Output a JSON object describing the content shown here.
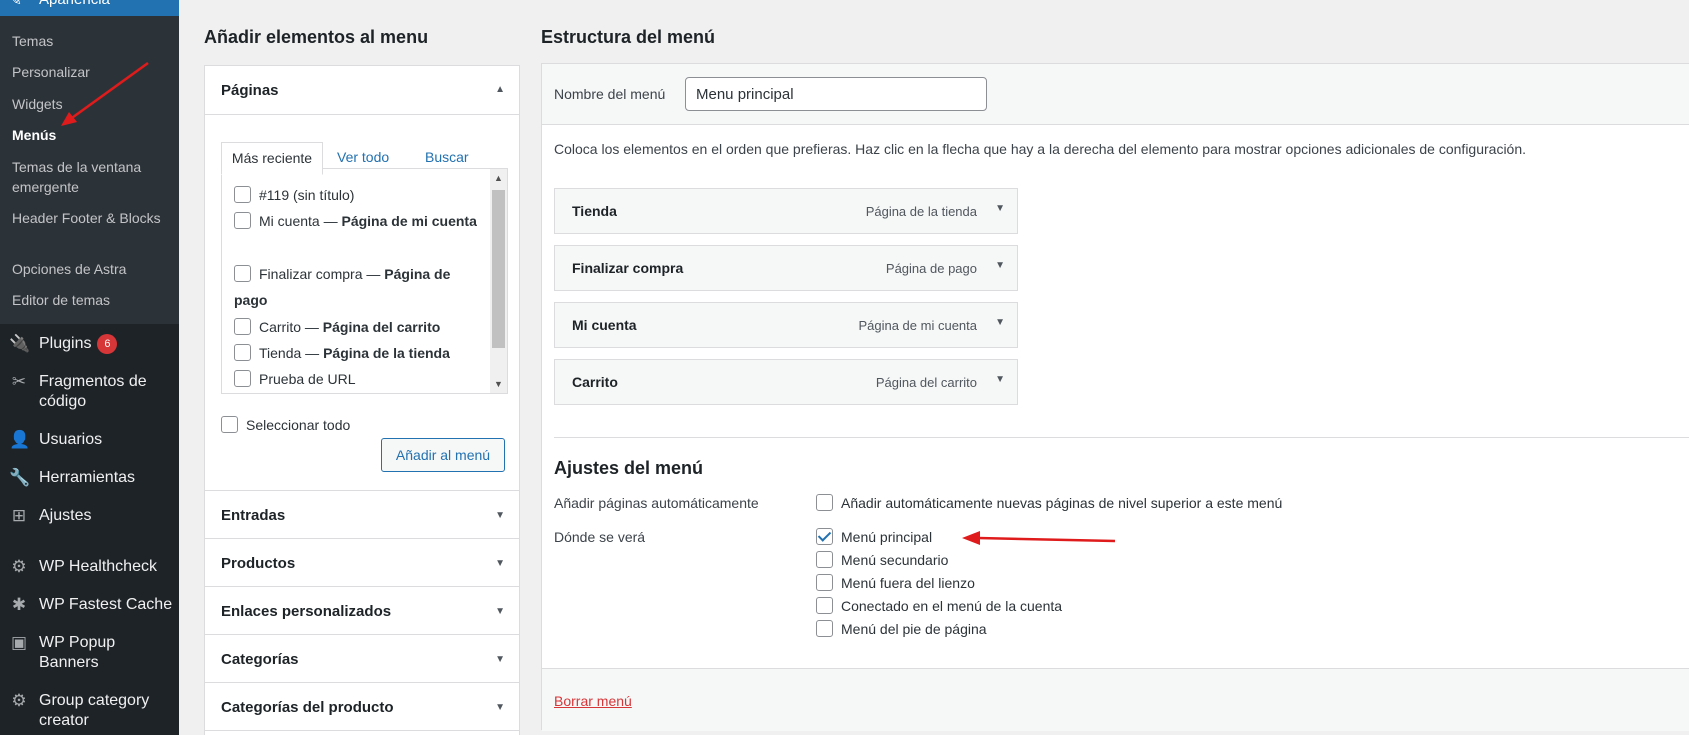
{
  "sidebar": {
    "current_section": "Apariencia",
    "submenu": [
      "Temas",
      "Personalizar",
      "Widgets",
      "Menús",
      "Temas de la ventana emergente",
      "Header Footer & Blocks",
      "Opciones de Astra",
      "Editor de temas"
    ],
    "items": [
      {
        "label": "Plugins",
        "icon": "plugin-icon",
        "badge": "6"
      },
      {
        "label": "Fragmentos de código",
        "icon": "scissors-icon"
      },
      {
        "label": "Usuarios",
        "icon": "user-icon"
      },
      {
        "label": "Herramientas",
        "icon": "wrench-icon"
      },
      {
        "label": "Ajustes",
        "icon": "settings-icon"
      },
      {
        "label": "WP Healthcheck",
        "icon": "gear-icon"
      },
      {
        "label": "WP Fastest Cache",
        "icon": "cheetah-icon"
      },
      {
        "label": "WP Popup Banners",
        "icon": "popup-icon"
      },
      {
        "label": "Group category creator",
        "icon": "gear-icon"
      }
    ]
  },
  "add_items": {
    "heading": "Añadir elementos al menu",
    "pages_title": "Páginas",
    "tabs": [
      "Más reciente",
      "Ver todo",
      "Buscar"
    ],
    "pages": [
      {
        "name": "#119 (sin título)",
        "type": ""
      },
      {
        "name": "Mi cuenta — ",
        "type": "Página de mi cuenta"
      },
      {
        "name": "Finalizar compra — ",
        "type": "Página de pago"
      },
      {
        "name": "Carrito — ",
        "type": "Página del carrito"
      },
      {
        "name": "Tienda — ",
        "type": "Página de la tienda"
      },
      {
        "name": "Prueba de URL",
        "type": ""
      }
    ],
    "select_all": "Seleccionar todo",
    "add_button": "Añadir al menú",
    "sections": [
      "Entradas",
      "Productos",
      "Enlaces personalizados",
      "Categorías",
      "Categorías del producto"
    ]
  },
  "structure": {
    "heading": "Estructura del menú",
    "name_label": "Nombre del menú",
    "name_value": "Menu principal",
    "instructions": "Coloca los elementos en el orden que prefieras. Haz clic en la flecha que hay a la derecha del elemento para mostrar opciones adicionales de configuración.",
    "menu_items": [
      {
        "title": "Tienda",
        "type": "Página de la tienda"
      },
      {
        "title": "Finalizar compra",
        "type": "Página de pago"
      },
      {
        "title": "Mi cuenta",
        "type": "Página de mi cuenta"
      },
      {
        "title": "Carrito",
        "type": "Página del carrito"
      }
    ],
    "settings_title": "Ajustes del menú",
    "auto_add_label": "Añadir páginas automáticamente",
    "auto_add_option": "Añadir automáticamente nuevas páginas de nivel superior a este menú",
    "location_label": "Dónde se verá",
    "locations": [
      {
        "label": "Menú principal",
        "checked": true
      },
      {
        "label": "Menú secundario",
        "checked": false
      },
      {
        "label": "Menú fuera del lienzo",
        "checked": false
      },
      {
        "label": "Conectado en el menú de la cuenta",
        "checked": false
      },
      {
        "label": "Menú del pie de página",
        "checked": false
      }
    ],
    "delete_link": "Borrar menú"
  },
  "colors": {
    "accent": "#2271b1",
    "sidebar": "#1d2327",
    "annotation_arrow": "#e01b1b"
  }
}
